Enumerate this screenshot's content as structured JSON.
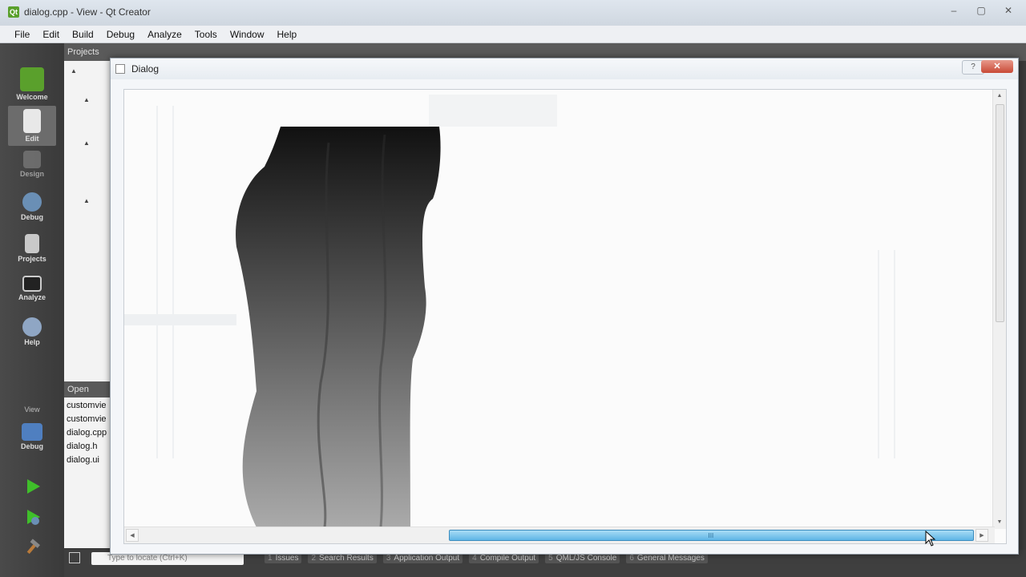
{
  "window": {
    "title": "dialog.cpp - View - Qt Creator",
    "controls": [
      "–",
      "▢",
      "✕"
    ]
  },
  "menu": [
    "File",
    "Edit",
    "Build",
    "Debug",
    "Analyze",
    "Tools",
    "Window",
    "Help"
  ],
  "modes": [
    {
      "label": "Welcome",
      "icon": "qt-logo-icon"
    },
    {
      "label": "Edit",
      "icon": "edit-document-icon"
    },
    {
      "label": "Design",
      "icon": "design-pen-icon"
    },
    {
      "label": "Debug",
      "icon": "debug-icon"
    },
    {
      "label": "Projects",
      "icon": "projects-icon"
    },
    {
      "label": "Analyze",
      "icon": "analyze-monitor-icon"
    },
    {
      "label": "Help",
      "icon": "help-icon"
    }
  ],
  "kit_selector": {
    "section": "View",
    "label": "Debug"
  },
  "projects_panel": {
    "header": "Projects"
  },
  "open_documents": {
    "header": "Open Doc...",
    "files": [
      "customvie",
      "customvie",
      "dialog.cpp",
      "dialog.h",
      "dialog.ui"
    ]
  },
  "locator": {
    "placeholder": "Type to locate (Ctrl+K)"
  },
  "output_tabs": [
    {
      "num": "1",
      "label": "Issues"
    },
    {
      "num": "2",
      "label": "Search Results"
    },
    {
      "num": "3",
      "label": "Application Output"
    },
    {
      "num": "4",
      "label": "Compile Output"
    },
    {
      "num": "5",
      "label": "QML/JS Console"
    },
    {
      "num": "6",
      "label": "General Messages"
    }
  ],
  "dialog": {
    "title": "Dialog",
    "help_label": "?",
    "close_label": "✕",
    "hscroll_grip": "III"
  },
  "scroll": {
    "horizontal_thumb_fraction": 0.63,
    "horizontal_position_fraction": 1.0
  },
  "colors": {
    "accent": "#5fb5e6",
    "close": "#c84a36",
    "run": "#3fbf2a"
  }
}
